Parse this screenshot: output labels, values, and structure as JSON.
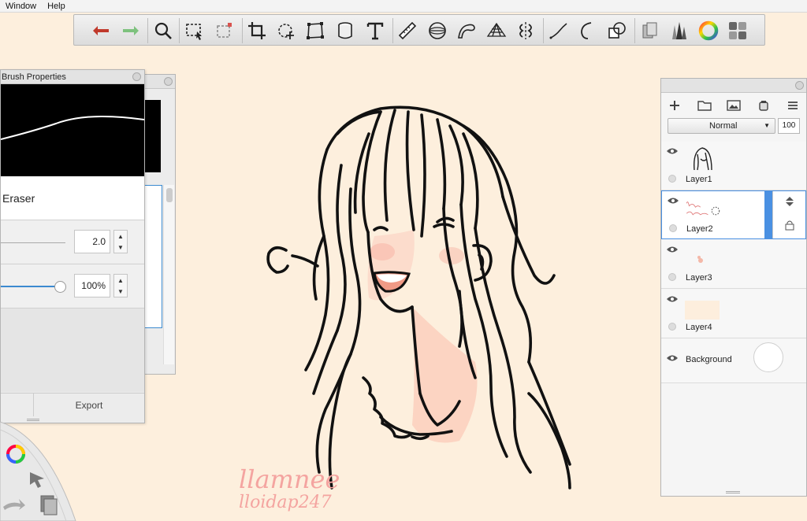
{
  "menu": {
    "items": [
      "Window",
      "Help"
    ]
  },
  "toolbar": {
    "tools": [
      "undo-icon",
      "redo-icon",
      "zoom-icon",
      "select-rect-icon",
      "select-crop-icon",
      "crop-icon",
      "transform-icon",
      "distort-icon",
      "fill-bucket-icon",
      "text-icon",
      "ruler-icon",
      "ellipse-guide-icon",
      "french-curve-icon",
      "perspective-icon",
      "symmetry-icon",
      "stroke-icon",
      "predictive-stroke-icon",
      "shape-icon",
      "copic-icon",
      "brush-library-icon",
      "color-wheel-icon",
      "ui-layout-icon"
    ]
  },
  "brush_properties": {
    "title": "Brush Properties",
    "brush_name": "Eraser",
    "size_value": "2.0",
    "opacity_value": "100%",
    "footer_left": "",
    "footer_right": "Export",
    "opacity_fill": 1.0
  },
  "layers": {
    "blend_mode": "Normal",
    "opacity": "100",
    "items": [
      {
        "name": "Layer1"
      },
      {
        "name": "Layer2"
      },
      {
        "name": "Layer3"
      },
      {
        "name": "Layer4"
      },
      {
        "name": "Background"
      }
    ]
  },
  "canvas": {
    "signature": "llamnee",
    "signature2": "lloidap247"
  },
  "colors": {
    "canvas_bg": "#fdefdd",
    "accent": "#4a90e2",
    "undo": "#c0392b",
    "redo": "#7ec27e"
  }
}
